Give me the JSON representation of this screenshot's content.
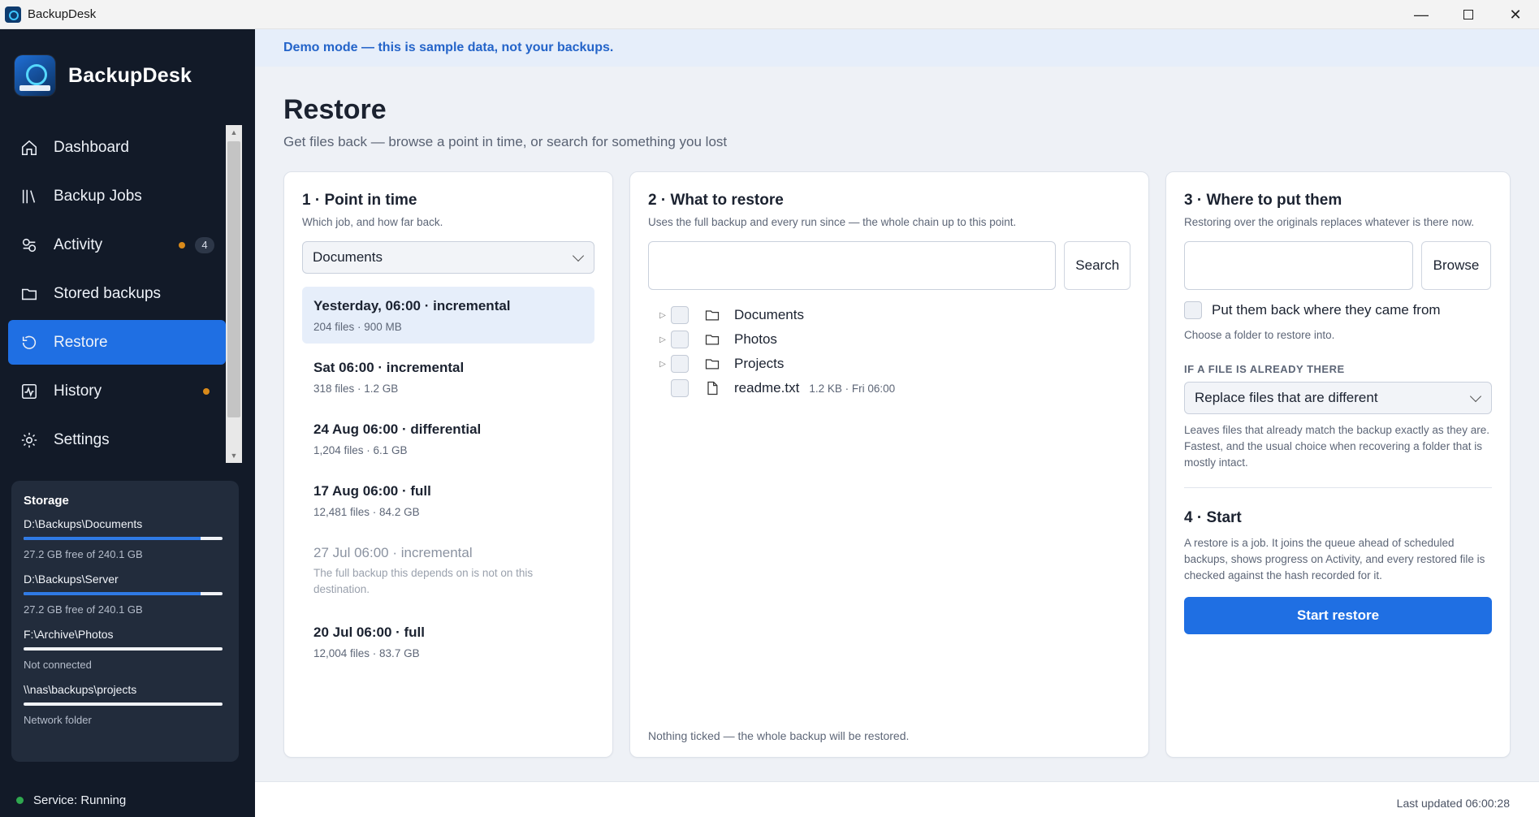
{
  "window": {
    "title": "BackupDesk",
    "controls": [
      "minimize-icon",
      "maximize-icon",
      "close-icon"
    ]
  },
  "sidebar": {
    "brand": "BackupDesk",
    "items": [
      {
        "label": "Dashboard",
        "icon": "home-icon"
      },
      {
        "label": "Backup Jobs",
        "icon": "library-icon"
      },
      {
        "label": "Activity",
        "icon": "activity-icon",
        "badge": "4"
      },
      {
        "label": "Stored backups",
        "icon": "folder-icon"
      },
      {
        "label": "Restore",
        "icon": "restore-icon",
        "active": true
      },
      {
        "label": "History",
        "icon": "history-icon"
      },
      {
        "label": "Settings",
        "icon": "gear-icon"
      }
    ],
    "storage": {
      "title": "Storage",
      "items": [
        {
          "path": "D:\\Backups\\Documents",
          "status": "27.2 GB free of 240.1 GB",
          "used_fraction": 0.89
        },
        {
          "path": "D:\\Backups\\Server",
          "status": "27.2 GB free of 240.1 GB",
          "used_fraction": 0.89
        },
        {
          "path": "F:\\Archive\\Photos",
          "status": "Not connected",
          "used_fraction": 0
        },
        {
          "path": "\\\\nas\\backups\\projects",
          "status": "Network folder",
          "used_fraction": 0
        }
      ]
    },
    "service": "Service: Running"
  },
  "main": {
    "banner": "Demo mode — this is sample data, not your backups.",
    "title": "Restore",
    "subtitle": "Get files back — browse a point in time, or search for something you lost",
    "point": {
      "heading": "1 · Point in time",
      "sub": "Which job, and how far back.",
      "job_selected": "Documents",
      "items": [
        {
          "title": "Yesterday, 06:00 · incremental",
          "meta": "204 files · 900 MB",
          "selected": true
        },
        {
          "title": "Sat 06:00 · incremental",
          "meta": "318 files · 1.2 GB"
        },
        {
          "title": "24 Aug 06:00 · differential",
          "meta": "1,204 files · 6.1 GB"
        },
        {
          "title": "17 Aug 06:00 · full",
          "meta": "12,481 files · 84.2 GB"
        },
        {
          "title": "27 Jul 06:00 · incremental",
          "meta": "The full backup this depends on is not on this destination.",
          "disabled": true
        },
        {
          "title": "20 Jul 06:00 · full",
          "meta": "12,004 files · 83.7 GB"
        }
      ]
    },
    "what": {
      "heading": "2 · What to restore",
      "sub": "Uses the full backup and every run since — the whole chain up to this point.",
      "search_value": "",
      "search_label": "Search",
      "tree": [
        {
          "name": "Documents",
          "type": "folder"
        },
        {
          "name": "Photos",
          "type": "folder"
        },
        {
          "name": "Projects",
          "type": "folder"
        },
        {
          "name": "readme.txt",
          "type": "file",
          "meta": "1.2 KB · Fri 06:00"
        }
      ],
      "footer": "Nothing ticked — the whole backup will be restored."
    },
    "where": {
      "heading": "3 · Where to put them",
      "sub": "Restoring over the originals replaces whatever is there now.",
      "dest_value": "",
      "browse_label": "Browse",
      "original_label": "Put them back where they came from",
      "choose_hint": "Choose a folder to restore into.",
      "conflict_label": "IF A FILE IS ALREADY THERE",
      "conflict_selected": "Replace files that are different",
      "conflict_hint": "Leaves files that already match the backup exactly as they are. Fastest, and the usual choice when recovering a folder that is mostly intact.",
      "start_heading": "4 · Start",
      "start_hint": "A restore is a job. It joins the queue ahead of scheduled backups, shows progress on Activity, and every restored file is checked against the hash recorded for it.",
      "start_label": "Start restore"
    },
    "last_updated": "Last updated 06:00:28"
  },
  "colors": {
    "accent": "#1f6fe3",
    "sidebar_bg": "#121a28",
    "warning_dot": "#d98a1a",
    "running_dot": "#2fa84f"
  }
}
